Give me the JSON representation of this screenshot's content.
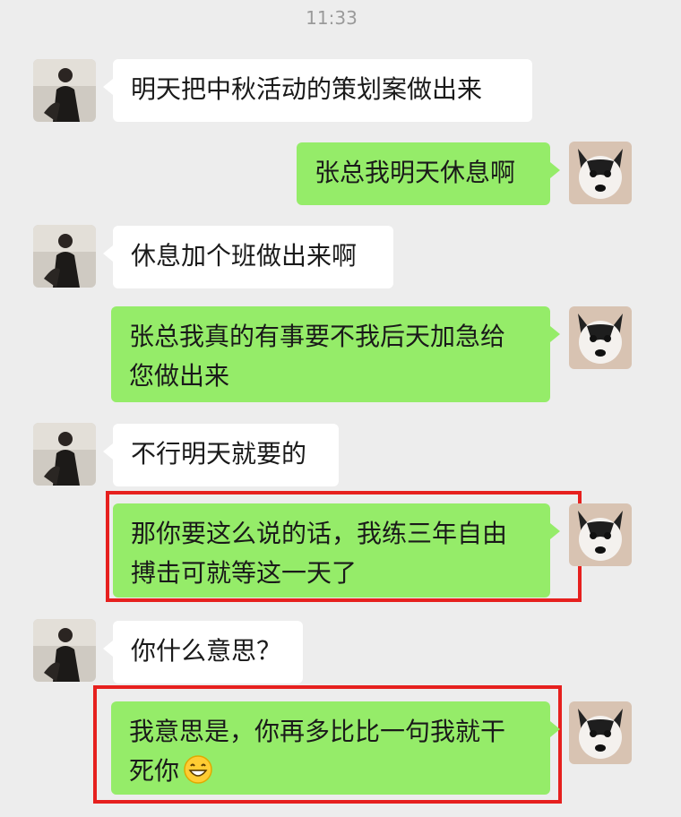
{
  "chat": {
    "timestamp": "11:33",
    "messages": [
      {
        "side": "left",
        "text": "明天把中秋活动的策划案做出来"
      },
      {
        "side": "right",
        "text": "张总我明天休息啊"
      },
      {
        "side": "left",
        "text": "休息加个班做出来啊"
      },
      {
        "side": "right",
        "line1": "张总我真的有事要不我后天加急给",
        "line2": "您做出来"
      },
      {
        "side": "left",
        "text": "不行明天就要的"
      },
      {
        "side": "right",
        "line1": "那你要这么说的话，我练三年自由",
        "line2": "搏击可就等这一天了"
      },
      {
        "side": "left",
        "text": "你什么意思？"
      },
      {
        "side": "right",
        "line1": "我意思是，你再多比比一句我就干",
        "line2": "死你",
        "emoji": "grinning-face-emoji"
      }
    ]
  },
  "colors": {
    "background": "#ededed",
    "incoming_bubble": "#ffffff",
    "outgoing_bubble": "#95ec69",
    "highlight_box": "#e6201e"
  }
}
